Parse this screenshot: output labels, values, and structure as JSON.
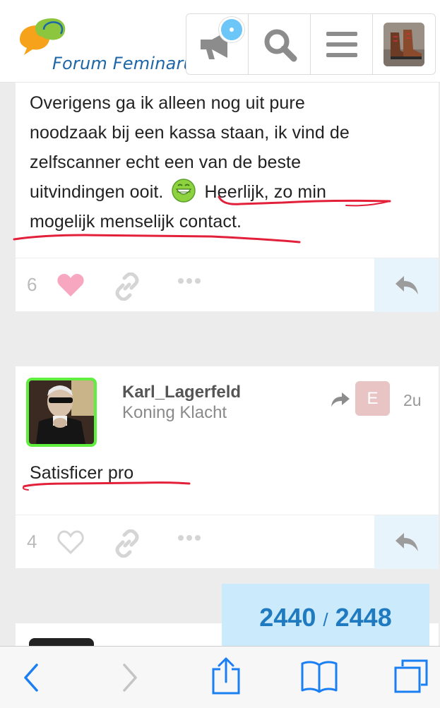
{
  "header": {
    "logo_text": "Forum Feminarum",
    "icons": [
      "megaphone-icon",
      "search-icon",
      "hamburger-menu-icon",
      "user-avatar"
    ]
  },
  "post1": {
    "lines": [
      "Overigens ga ik alleen nog uit pure",
      "noodzaak bij een kassa staan, ik vind de",
      "zelfscanner echt een van de beste",
      "uitvindingen ooit.",
      "Heerlijk, zo min",
      "mogelijk menselijk contact."
    ],
    "likes": "6"
  },
  "post2": {
    "username": "Karl_Lagerfeld",
    "user_title": "Koning Klacht",
    "badge_letter": "E",
    "time": "2u",
    "text": "Satisficer pro",
    "likes": "4"
  },
  "counter": {
    "current": "2440",
    "separator": "/",
    "total": "2448"
  },
  "colors": {
    "accent_blue": "#1f7ac0",
    "reply_bg": "#e8f4fc",
    "annotation_red": "#e3203a",
    "heart_pink": "#f7a8c0",
    "avatar_border": "#5fef3f"
  }
}
